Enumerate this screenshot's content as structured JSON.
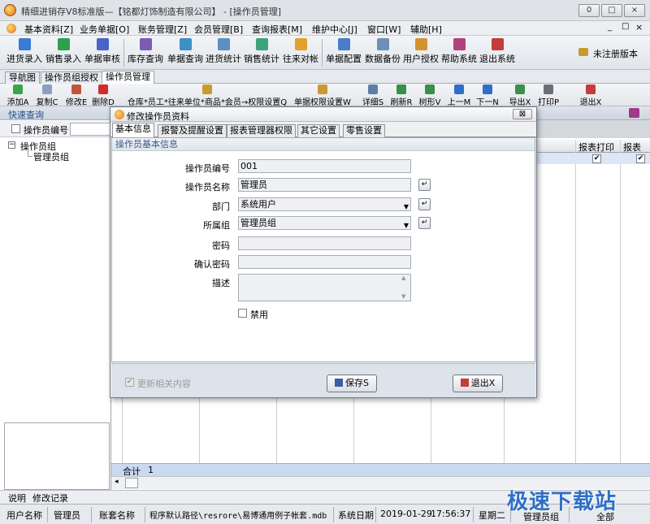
{
  "window": {
    "title": "精细进销存V8标准版—【铭都灯饰制造有限公司】 - [操作员管理]",
    "controls": [
      "0",
      "□",
      "×"
    ]
  },
  "menubar": {
    "items": [
      "基本资料[Z]",
      "业务单据[O]",
      "账务管理[Z]",
      "会员管理[B]",
      "查询报表[M]",
      "维护中心[J]",
      "窗口[W]",
      "辅助[H]"
    ],
    "controls": [
      "_",
      "□",
      "×"
    ]
  },
  "toolbar": {
    "items": [
      "进货录入",
      "销售录入",
      "单据审核",
      "库存查询",
      "单据查询",
      "进货统计",
      "销售统计",
      "往来对帐",
      "单据配置",
      "数据备份",
      "用户授权",
      "帮助系统",
      "退出系统"
    ],
    "unregistered": "未注册版本"
  },
  "tabs": [
    "导航图",
    "操作员组授权",
    "操作员管理"
  ],
  "toolbar2": {
    "left": [
      "添加A",
      "复制C",
      "修改E",
      "删除D"
    ],
    "middle": [
      "仓库*员工*往来单位*商品*会员→权限设置Q",
      "单据权限设置W"
    ],
    "right": [
      "详细S",
      "刷新R",
      "树形V",
      "上一M",
      "下一N",
      "导出X",
      "打印P",
      "退出X"
    ]
  },
  "quick": {
    "label": "快速查询"
  },
  "left": {
    "filter_label": "操作员编号",
    "tree_root": "操作员组",
    "tree_child": "管理员组"
  },
  "grid": {
    "headers": [
      "报表打印",
      "报表"
    ],
    "sum_label": "合计",
    "sum_value": "1"
  },
  "bottom_tabs": [
    "说明",
    "修改记录"
  ],
  "status": {
    "user_label": "用户名称",
    "user_value": "管理员",
    "account_label": "账套名称",
    "path": "程序默认路径\\resrore\\易博通用例子帐套.mdb",
    "date_label": "系统日期",
    "date": "2019-01-29",
    "time": "17:56:37",
    "weekday": "星期二",
    "group": "管理员组",
    "scope": "全部"
  },
  "dialog": {
    "title": "修改操作员资料",
    "close": "⊠",
    "tabs": [
      "基本信息",
      "报警及提醒设置",
      "报表管理器权限",
      "其它设置",
      "零售设置"
    ],
    "section": "操作员基本信息",
    "fields": {
      "code_label": "操作员编号",
      "code": "001",
      "name_label": "操作员名称",
      "name": "管理员",
      "dept_label": "部门",
      "dept": "系统用户",
      "group_label": "所属组",
      "group": "管理员组",
      "pwd_label": "密码",
      "pwd": "",
      "pwd2_label": "确认密码",
      "pwd2": "",
      "desc_label": "描述",
      "desc": "",
      "disable_label": "禁用"
    },
    "update_related": "更新相关内容",
    "save": "保存S",
    "exit": "退出X"
  },
  "watermark": "极速下载站"
}
